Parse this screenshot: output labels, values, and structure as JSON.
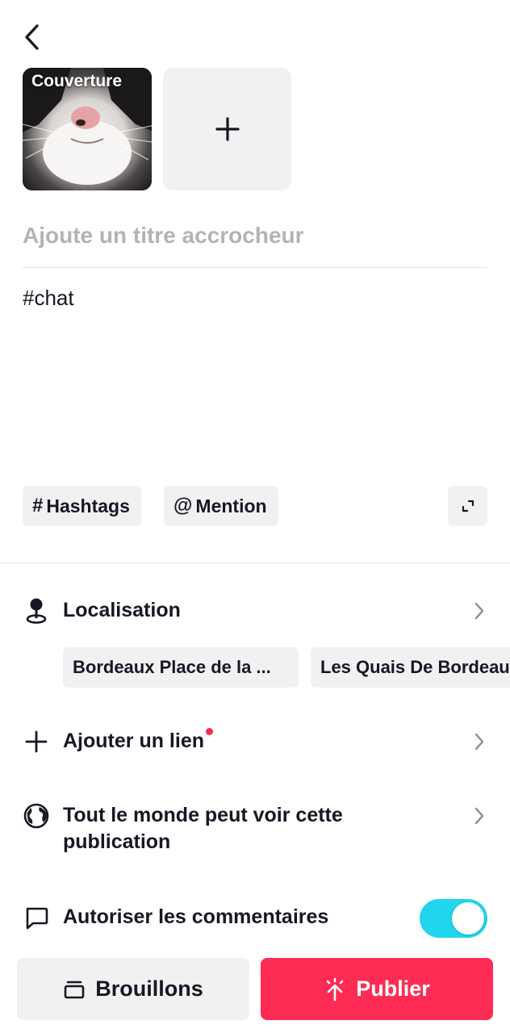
{
  "header": {
    "back_icon": "chevron-left-icon"
  },
  "media": {
    "cover_label": "Couverture",
    "add_icon": "plus-icon"
  },
  "post": {
    "title_placeholder": "Ajoute un titre accrocheur",
    "title_value": "",
    "description": "#chat"
  },
  "tools": {
    "hashtags_symbol": "#",
    "hashtags_label": "Hashtags",
    "mention_symbol": "@",
    "mention_label": "Mention",
    "expand_icon": "expand-icon"
  },
  "settings": {
    "location": {
      "label": "Localisation",
      "icon": "location-pin-icon",
      "suggestions": [
        "Bordeaux Place de la ...",
        "Les Quais De Bordeaux"
      ]
    },
    "link": {
      "label": "Ajouter un lien",
      "icon": "plus-icon",
      "has_new_badge": true
    },
    "privacy": {
      "label": "Tout le monde peut voir cette publication",
      "icon": "globe-icon"
    },
    "comments": {
      "label": "Autoriser les commentaires",
      "icon": "comment-icon",
      "enabled": true
    }
  },
  "actions": {
    "drafts_label": "Brouillons",
    "drafts_icon": "drafts-icon",
    "publish_label": "Publier",
    "publish_icon": "publish-icon"
  },
  "colors": {
    "accent": "#fe2c55",
    "toggle_on": "#20d5ec",
    "chip_bg": "#f1f1f2",
    "placeholder": "#b3b3b6"
  }
}
